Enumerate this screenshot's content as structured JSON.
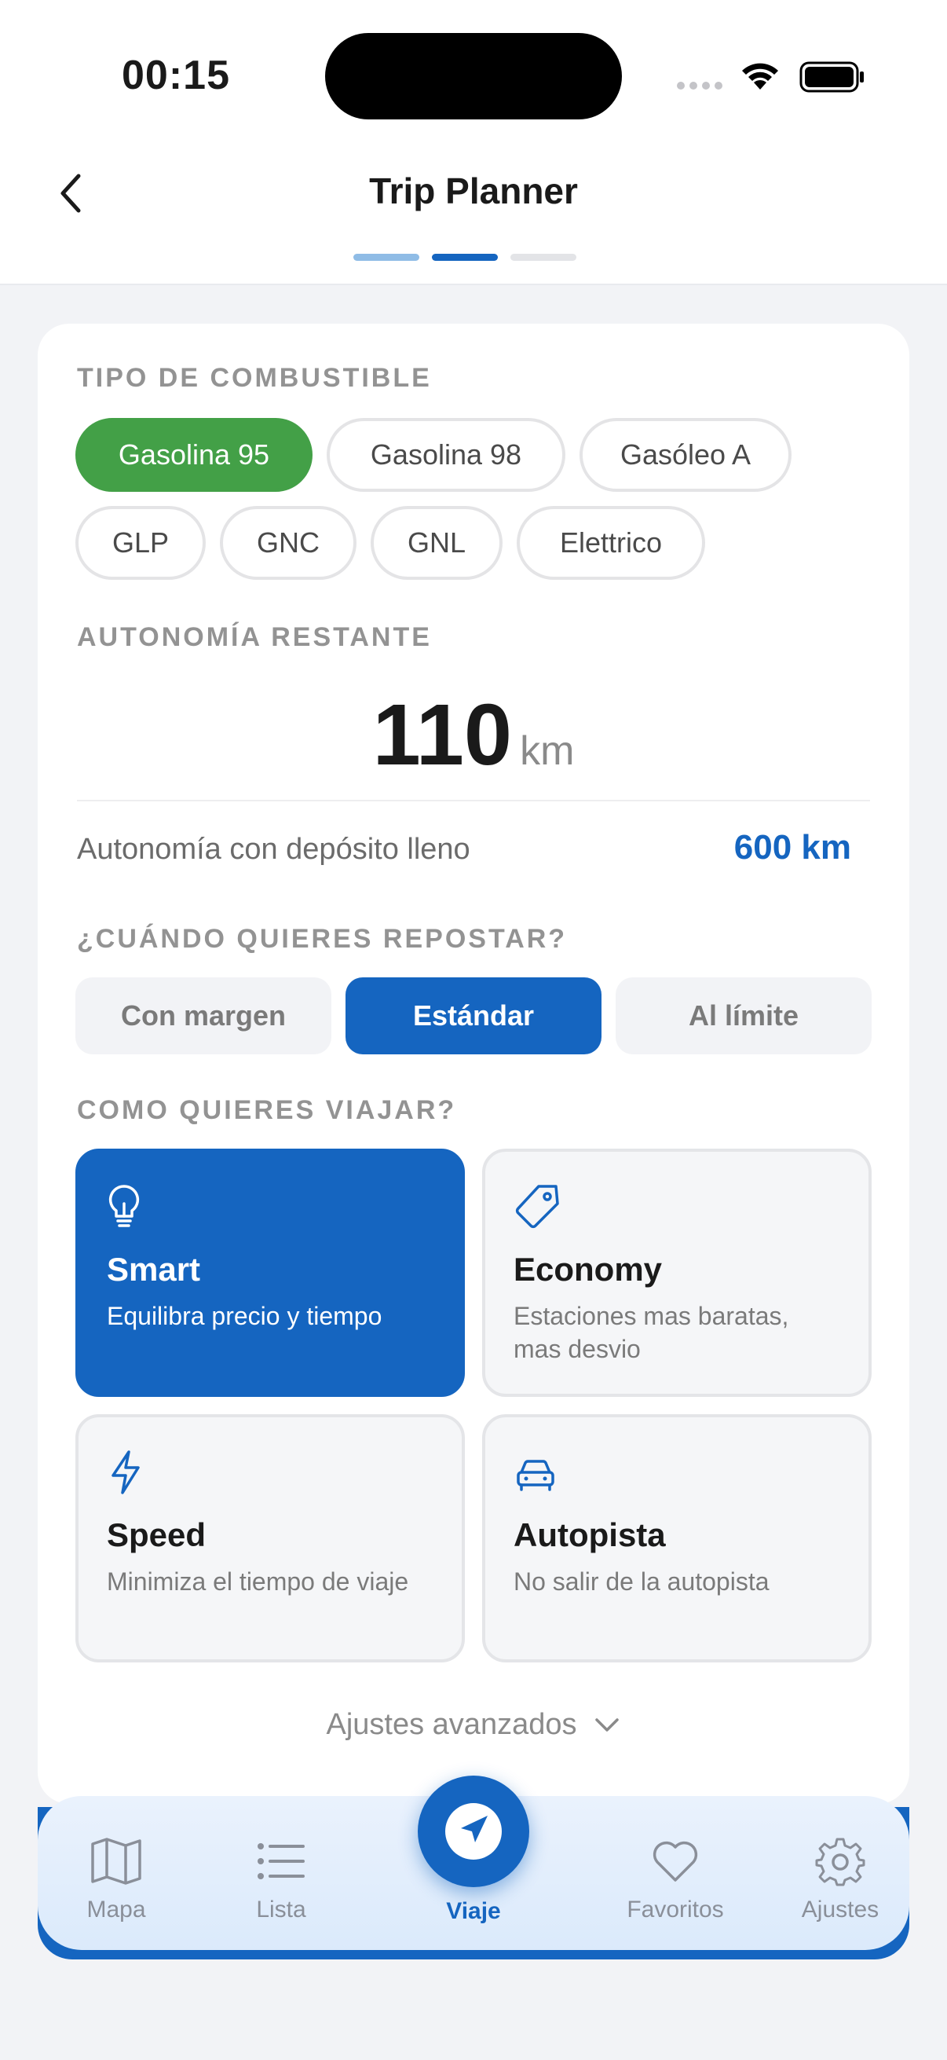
{
  "status_bar": {
    "time": "00:15"
  },
  "header": {
    "title": "Trip Planner",
    "steps": 3,
    "current_step": 2
  },
  "fuel": {
    "label": "TIPO DE COMBUSTIBLE",
    "options": [
      "Gasolina 95",
      "Gasolina 98",
      "Gasóleo A",
      "GLP",
      "GNC",
      "GNL",
      "Elettrico"
    ],
    "selected": "Gasolina 95"
  },
  "range": {
    "label": "AUTONOMÍA RESTANTE",
    "value": "110",
    "unit": "km",
    "full_label": "Autonomía con depósito lleno",
    "full_value": "600 km"
  },
  "refuel": {
    "label": "¿CUÁNDO QUIERES REPOSTAR?",
    "options": [
      "Con margen",
      "Estándar",
      "Al límite"
    ],
    "selected": "Estándar"
  },
  "travel": {
    "label": "COMO QUIERES VIAJAR?",
    "modes": [
      {
        "title": "Smart",
        "desc": "Equilibra precio y tiempo",
        "icon": "lightbulb-icon"
      },
      {
        "title": "Economy",
        "desc": "Estaciones mas baratas, mas desvio",
        "icon": "price-tag-icon"
      },
      {
        "title": "Speed",
        "desc": "Minimiza el tiempo de viaje",
        "icon": "lightning-icon"
      },
      {
        "title": "Autopista",
        "desc": "No salir de la autopista",
        "icon": "car-icon"
      }
    ],
    "selected": "Smart"
  },
  "advanced": {
    "label": "Ajustes avanzados"
  },
  "nav": {
    "items": [
      "Mapa",
      "Lista",
      "Viaje",
      "Favoritos",
      "Ajustes"
    ],
    "active": "Viaje"
  },
  "colors": {
    "primary": "#1565c0",
    "accent_green": "#43a047",
    "background": "#f2f3f6"
  }
}
